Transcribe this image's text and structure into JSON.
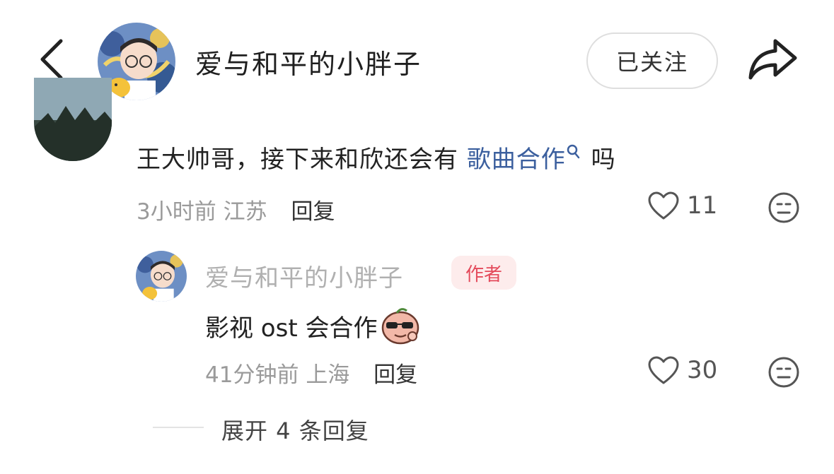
{
  "header": {
    "author_name": "爱与和平的小胖子",
    "follow_label": "已关注"
  },
  "comment": {
    "text_before": "王大帅哥，接下来和欣还会有 ",
    "link_text": "歌曲合作",
    "text_after": " 吗",
    "time": "3小时前",
    "location": "江苏",
    "reply_label": "回复",
    "likes": "11"
  },
  "reply": {
    "author_name": "爱与和平的小胖子",
    "badge": "作者",
    "text": "影视 ost 会合作",
    "time": "41分钟前",
    "location": "上海",
    "reply_label": "回复",
    "likes": "30"
  },
  "expand_label": "展开 4 条回复",
  "colors": {
    "link": "#3b5f9e",
    "badge_text": "#e44a5b",
    "badge_bg": "#fdecec",
    "meta": "#9a9a9a"
  }
}
